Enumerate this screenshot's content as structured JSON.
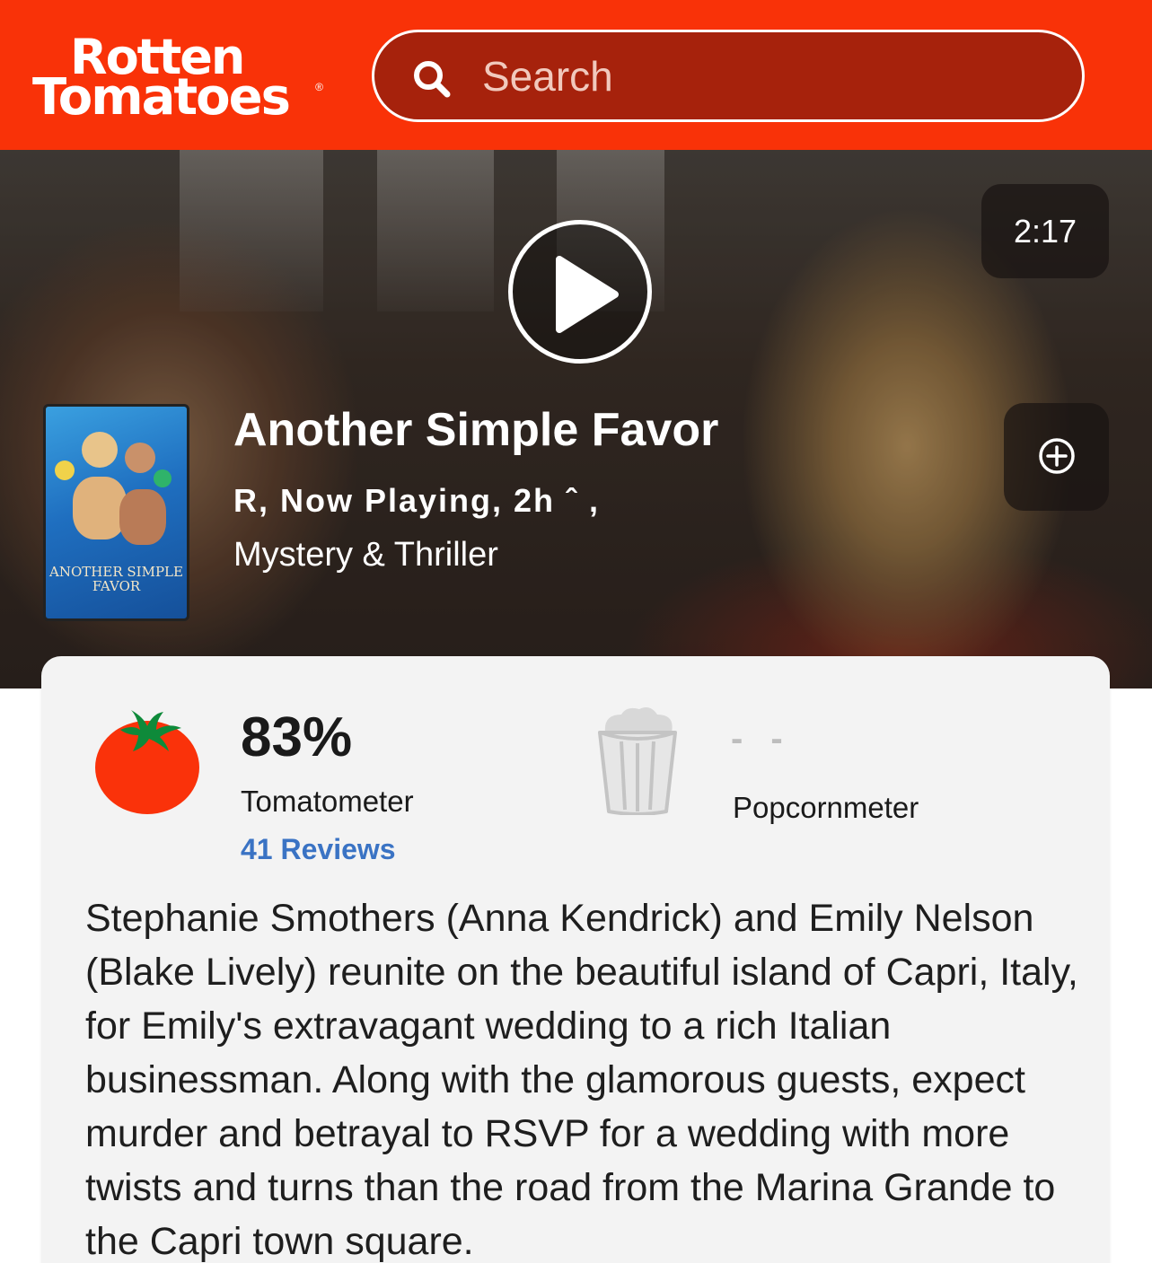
{
  "header": {
    "logo_line1": "Rotten",
    "logo_line2": "Tomatoes",
    "search_placeholder": "Search",
    "brand_color": "#f93208",
    "search_icon": "search-icon"
  },
  "hero": {
    "duration": "2:17",
    "play_icon": "play-icon",
    "add_icon": "plus-circle-icon",
    "poster_title": "ANOTHER SIMPLE FAVOR"
  },
  "movie": {
    "title": "Another Simple Favor",
    "meta": "R, Now Playing, 2h ˆ ,",
    "genre": "Mystery & Thriller"
  },
  "scores": {
    "tomatometer_value": "83%",
    "tomatometer_label": "Tomatometer",
    "reviews_link": "41 Reviews",
    "popcornmeter_value": "- -",
    "popcornmeter_label": "Popcornmeter",
    "tomato_icon": "tomato-icon",
    "popcorn_icon": "popcorn-icon",
    "link_color": "#3a73c4"
  },
  "synopsis": "Stephanie Smothers (Anna Kendrick) and Emily Nelson (Blake Lively) reunite on the beautiful island of Capri, Italy, for Emily's extravagant wedding to a rich Italian businessman. Along with the glamorous guests, expect murder and betrayal to RSVP for a wedding with more twists and turns than the road from the Marina Grande to the Capri town square."
}
